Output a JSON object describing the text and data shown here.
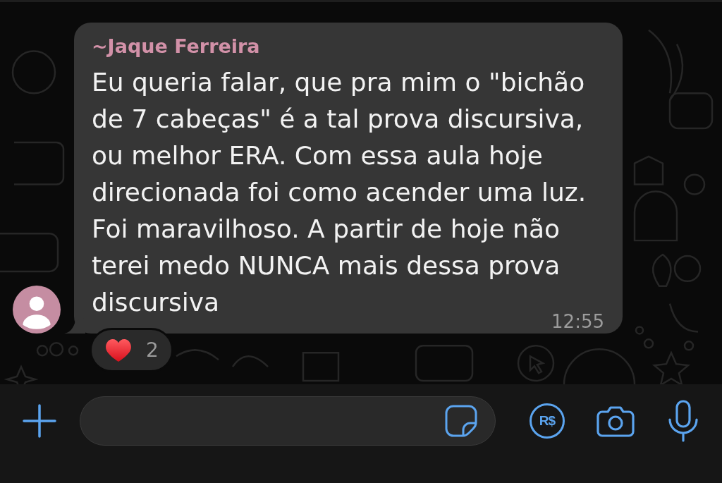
{
  "chat": {
    "message": {
      "sender": "~Jaque Ferreira",
      "text": "Eu queria falar, que pra mim o \"bichão de 7 cabeças\" é a tal prova discursiva, ou melhor ERA. Com essa aula hoje direcionada foi como acender uma luz. Foi maravilhoso. A partir de hoje não terei medo NUNCA mais dessa prova discursiva",
      "time": "12:55",
      "reactions": [
        {
          "count": "2"
        }
      ]
    }
  },
  "composer": {
    "payment_button": "R$"
  }
}
